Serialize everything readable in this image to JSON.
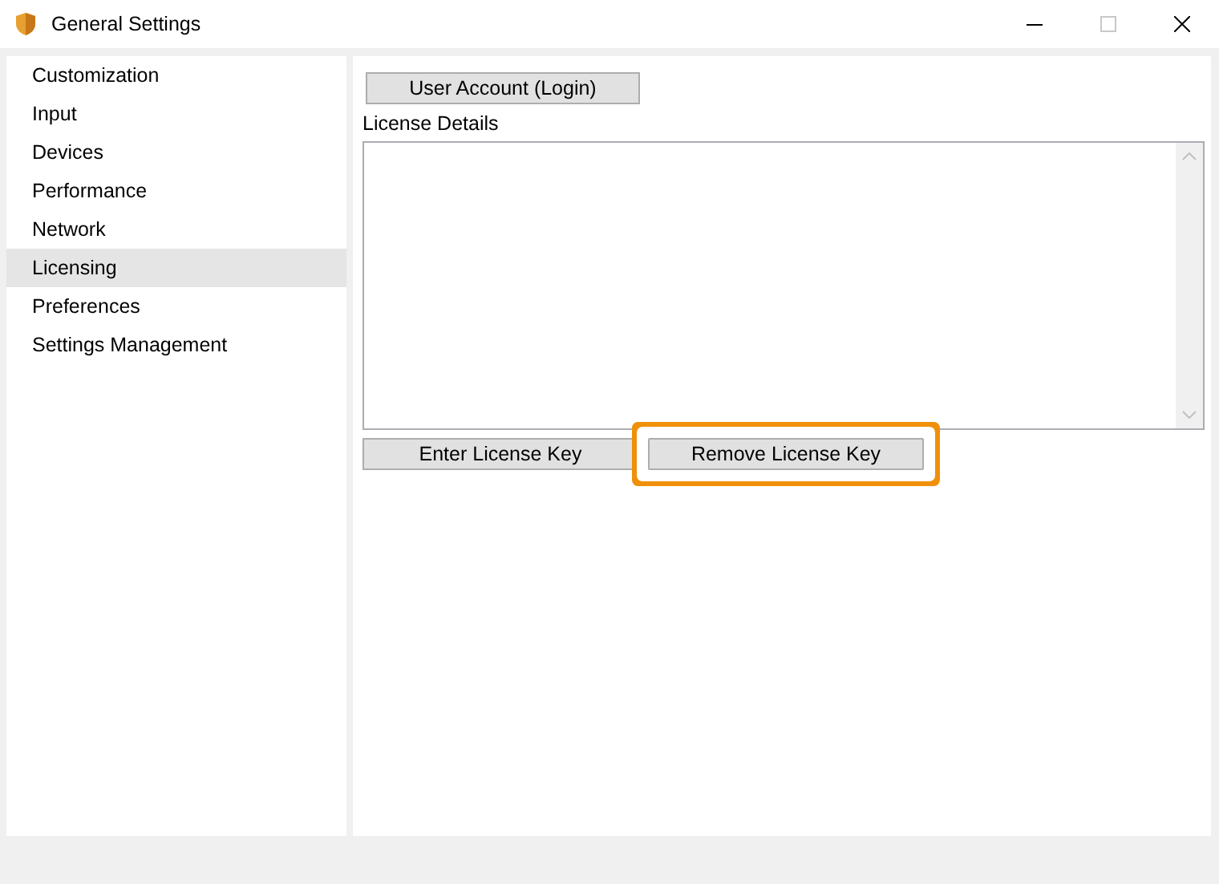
{
  "window": {
    "title": "General Settings",
    "maximize_disabled": true
  },
  "sidebar": {
    "items": [
      {
        "label": "Customization",
        "selected": false
      },
      {
        "label": "Input",
        "selected": false
      },
      {
        "label": "Devices",
        "selected": false
      },
      {
        "label": "Performance",
        "selected": false
      },
      {
        "label": "Network",
        "selected": false
      },
      {
        "label": "Licensing",
        "selected": true
      },
      {
        "label": "Preferences",
        "selected": false
      },
      {
        "label": "Settings Management",
        "selected": false
      }
    ]
  },
  "content": {
    "account_button": "User Account (Login)",
    "details_label": "License Details",
    "buttons": [
      {
        "label": "Enter License Key",
        "highlighted": false
      },
      {
        "label": "Remove License Key",
        "highlighted": true
      }
    ]
  }
}
